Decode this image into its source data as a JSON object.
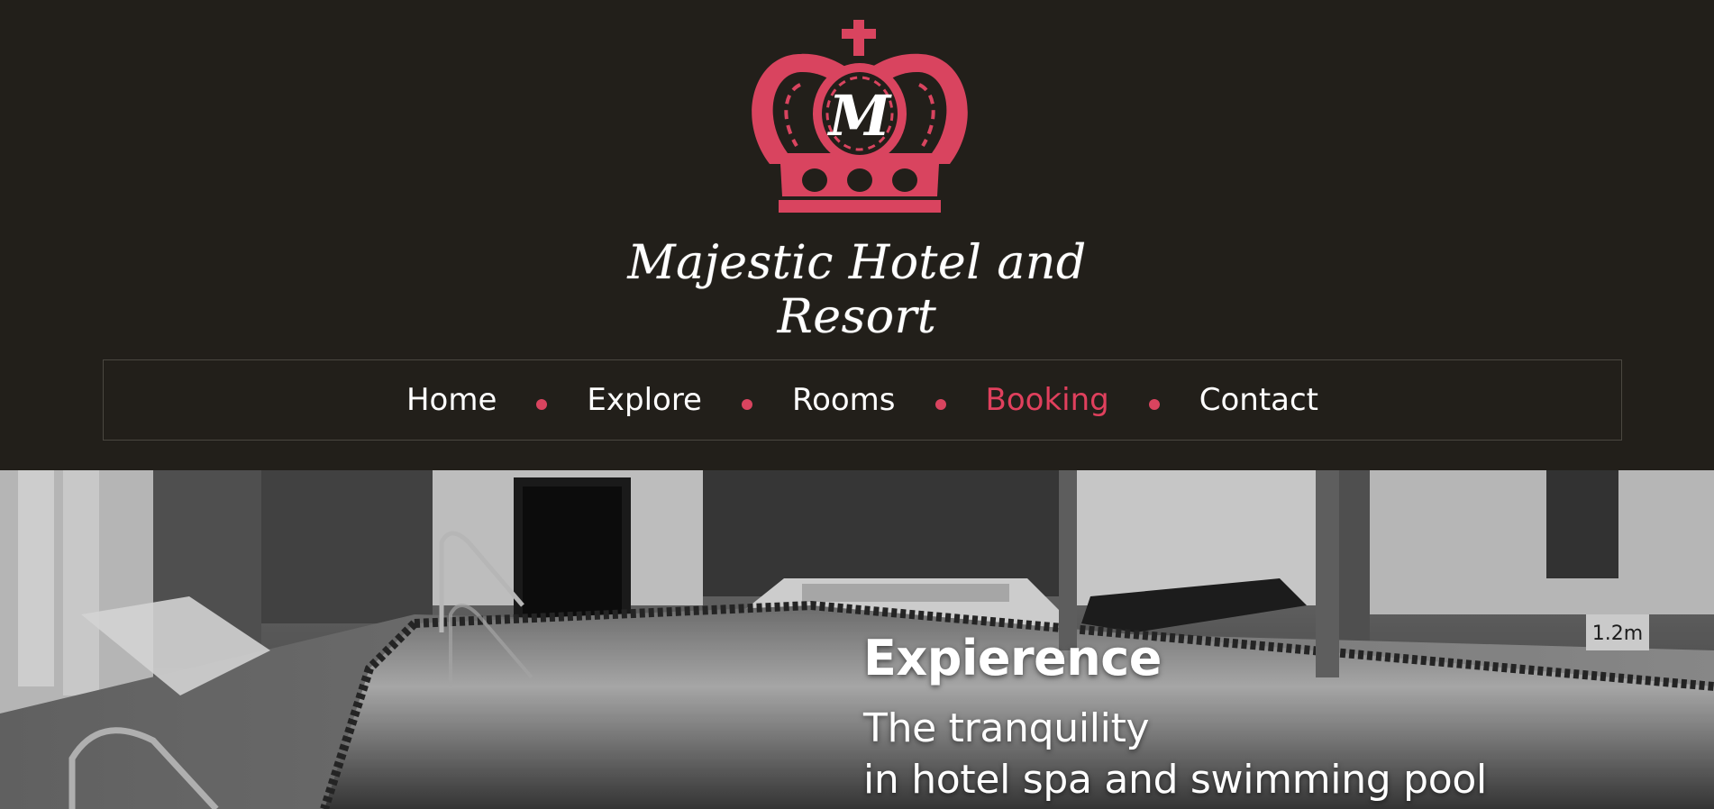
{
  "brand": {
    "monogram": "M",
    "name": "Majestic Hotel and Resort",
    "accent_color": "#d9445f",
    "background_color": "#221f1a"
  },
  "nav": {
    "items": [
      {
        "label": "Home",
        "active": false
      },
      {
        "label": "Explore",
        "active": false
      },
      {
        "label": "Rooms",
        "active": false
      },
      {
        "label": "Booking",
        "active": true
      },
      {
        "label": "Contact",
        "active": false
      }
    ],
    "separator_icon": "dot-icon"
  },
  "hero": {
    "title": "Expierence",
    "line1": "The tranquility",
    "line2": "in hotel spa and swimming pool",
    "image": "indoor-pool-photo"
  }
}
